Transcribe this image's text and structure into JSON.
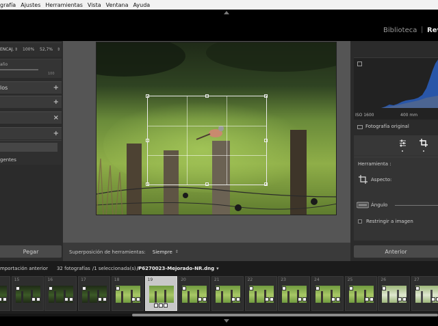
{
  "menu": [
    "grafía",
    "Ajustes",
    "Herramientas",
    "Vista",
    "Ventana",
    "Ayuda"
  ],
  "modules": {
    "library": "Biblioteca",
    "develop": "Rev",
    "separator": "|"
  },
  "left_panel": {
    "nav_label": "ENCAJ.",
    "nav_dd": "⇕",
    "zoom_100": "100%",
    "zoom_pct": "52,7%",
    "zoom_dd": "⇕",
    "slider_label": "año",
    "slider_value": "100",
    "section_presets": "los",
    "section_snapshots": "",
    "section_history": "",
    "section_collections": "",
    "coll_item": "gentes",
    "plus": "+",
    "x": "×",
    "paste_button": "Pegar"
  },
  "overlay_bar": {
    "label": "Superposición de herramientas:",
    "value": "Siempre",
    "dd": "⇕"
  },
  "right_panel": {
    "iso": "ISO 1600",
    "focal": "400 mm",
    "original_photo": "Fotografía original",
    "tool_label": "Herramienta :",
    "aspect_label": "Aspecto:",
    "angle_label": "Ángulo",
    "constrain_label": "Restringir a imagen",
    "previous_button": "Anterior"
  },
  "filmstrip_bar": {
    "source": "mportación anterior",
    "count": "32 fotografías",
    "selection": "/1 seleccionada(s)",
    "filename": "/P6270023-Mejorado-NR.dng",
    "dd": "▾"
  },
  "filmstrip": [
    {
      "num": "",
      "style": "dark"
    },
    {
      "num": "15",
      "style": "dark"
    },
    {
      "num": "16",
      "style": "dark"
    },
    {
      "num": "17",
      "style": "dark"
    },
    {
      "num": "18",
      "style": "green"
    },
    {
      "num": "19",
      "style": "green",
      "selected": true
    },
    {
      "num": "20",
      "style": "green"
    },
    {
      "num": "21",
      "style": "green"
    },
    {
      "num": "22",
      "style": "green"
    },
    {
      "num": "23",
      "style": "green"
    },
    {
      "num": "24",
      "style": "green"
    },
    {
      "num": "25",
      "style": "green"
    },
    {
      "num": "26",
      "style": "pale"
    },
    {
      "num": "27",
      "style": "pale"
    }
  ],
  "colors": {
    "histogram_blue": "#2a5fc0",
    "bg": "#161616",
    "panel": "#2b2b2b",
    "center": "#555555"
  }
}
